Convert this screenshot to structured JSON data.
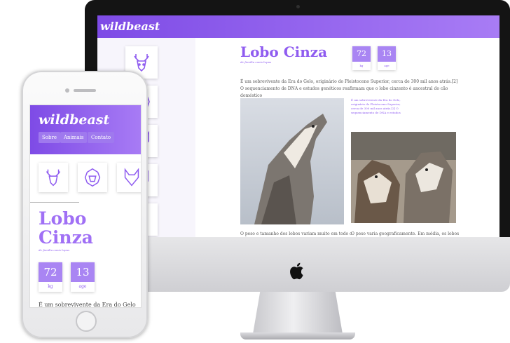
{
  "site": {
    "logo": "wildbeast",
    "nav": [
      "Sobre",
      "Animais",
      "Contato"
    ],
    "animal": {
      "title": "Lobo Cinza",
      "title_line1": "Lobo",
      "title_line2": "Cinza",
      "family": "de família canis lupus",
      "stats": [
        {
          "value": "72",
          "label": "kg"
        },
        {
          "value": "13",
          "label": "age"
        }
      ],
      "intro": "É um sobrevivente da Era do Gelo, originário do Pleistoceno Superior, cerca de 300 mil anos atrás.[2] O sequenciamento de DNA e estudos genéticos reafirmam que o lobo cinzento é ancestral do cão doméstico",
      "intro_short": "É um sobrevivente da Era do Gelo",
      "caption": "É um sobrevivente da Era do Gelo, originário do Pleistoceno Superior, cerca de 300 mil anos atrás.[2] O sequenciamento de DNA e estudos",
      "bottom_left": "O peso e tamanho dos lobos variam muito em todo o",
      "bottom_right": "O peso varia geograficamente. Em média, os lobos"
    }
  },
  "icons": [
    "deer-icon",
    "lion-icon",
    "fox-icon",
    "wolf-icon",
    "horse-icon",
    "owl-icon"
  ],
  "colors": {
    "accent": "#8f5cf0",
    "header_start": "#7e4be6",
    "header_end": "#a87cf5"
  }
}
